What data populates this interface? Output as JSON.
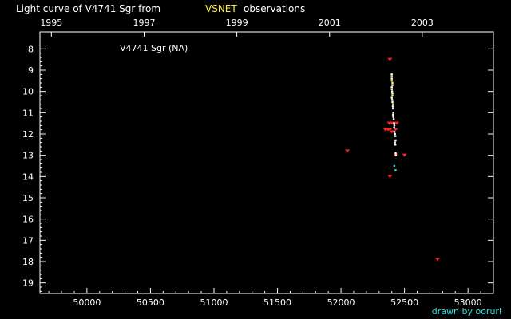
{
  "header": {
    "title_prefix": "Light curve of V4741 Sgr from",
    "title_source": "VSNET",
    "title_suffix": "observations"
  },
  "credit": "drawn by ooruri",
  "chart_data": {
    "type": "scatter",
    "title": "Light curve of V4741 Sgr from VSNET observations",
    "annotation": "V4741 Sgr (NA)",
    "x_axis": {
      "ticks": [
        50000,
        50500,
        51000,
        51500,
        52000,
        52500,
        53000
      ],
      "tick_labels": [
        "50000",
        "50500",
        "51000",
        "51500",
        "52000",
        "52500",
        "53000"
      ],
      "range": [
        49630,
        53200
      ]
    },
    "x_top_axis": {
      "tick_labels": [
        "1995",
        "1997",
        "1999",
        "2001",
        "2003"
      ],
      "values": [
        49720,
        50450,
        51180,
        51910,
        52640
      ]
    },
    "y_axis": {
      "ticks": [
        8,
        9,
        10,
        11,
        12,
        13,
        14,
        15,
        16,
        17,
        18,
        19
      ],
      "tick_labels": [
        "8",
        "9",
        "10",
        "11",
        "12",
        "13",
        "14",
        "15",
        "16",
        "17",
        "18",
        "19"
      ],
      "range": [
        7.2,
        19.5
      ],
      "inverted": true
    },
    "colors": {
      "upper_limit": "#ff2222",
      "visual": "#ffffff",
      "yellow": "#ffee44",
      "cyan": "#33dddd",
      "axes": "#ffffff"
    },
    "series": [
      {
        "marker": "v",
        "color": "#ff2222",
        "points": [
          [
            52050,
            12.8
          ],
          [
            52385,
            8.5
          ],
          [
            52350,
            11.8
          ],
          [
            52370,
            11.8
          ],
          [
            52385,
            11.8
          ],
          [
            52380,
            11.5
          ],
          [
            52400,
            11.5
          ],
          [
            52420,
            11.5
          ],
          [
            52440,
            11.5
          ],
          [
            52430,
            11.8
          ],
          [
            52400,
            11.9
          ],
          [
            52430,
            13.0
          ],
          [
            52500,
            13.0
          ],
          [
            52385,
            14.0
          ],
          [
            52760,
            17.9
          ]
        ]
      },
      {
        "marker": "dot",
        "color": "#ffee44",
        "points": [
          [
            52400,
            9.3
          ],
          [
            52400,
            9.5
          ],
          [
            52405,
            9.6
          ],
          [
            52400,
            9.9
          ],
          [
            52405,
            10.2
          ],
          [
            52410,
            10.6
          ]
        ]
      },
      {
        "marker": "dot",
        "color": "#ffffff",
        "points": [
          [
            52400,
            9.2
          ],
          [
            52400,
            9.4
          ],
          [
            52405,
            9.7
          ],
          [
            52400,
            9.8
          ],
          [
            52403,
            10.0
          ],
          [
            52405,
            10.1
          ],
          [
            52400,
            10.3
          ],
          [
            52403,
            10.4
          ],
          [
            52405,
            10.5
          ],
          [
            52408,
            10.7
          ],
          [
            52410,
            10.8
          ],
          [
            52412,
            11.0
          ],
          [
            52410,
            11.1
          ],
          [
            52412,
            11.2
          ],
          [
            52415,
            11.3
          ],
          [
            52418,
            11.5
          ],
          [
            52420,
            11.6
          ],
          [
            52418,
            11.7
          ],
          [
            52420,
            11.9
          ],
          [
            52425,
            12.0
          ],
          [
            52428,
            12.1
          ],
          [
            52430,
            12.3
          ],
          [
            52425,
            12.4
          ],
          [
            52428,
            12.5
          ],
          [
            52430,
            12.9
          ],
          [
            52432,
            13.0
          ]
        ]
      },
      {
        "marker": "dot",
        "color": "#33dddd",
        "points": [
          [
            52420,
            13.5
          ],
          [
            52430,
            13.7
          ]
        ]
      }
    ]
  }
}
